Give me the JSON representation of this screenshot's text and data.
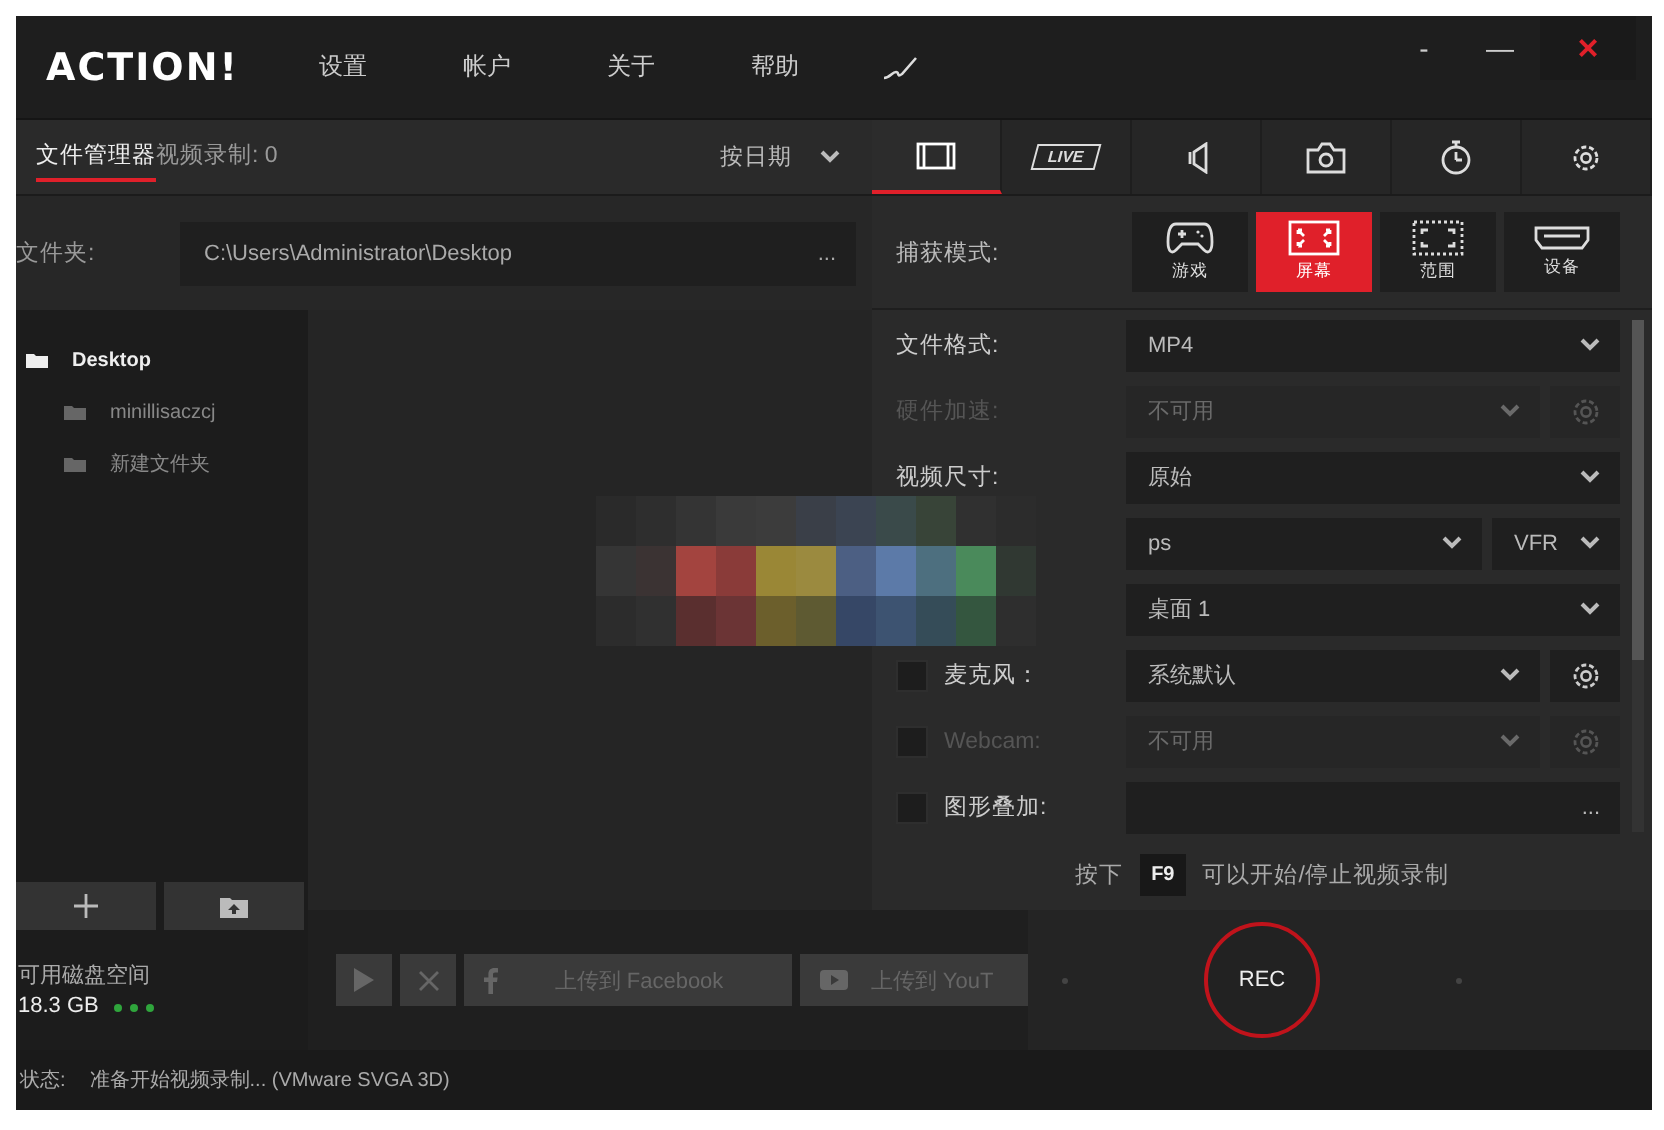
{
  "window": {
    "logo": "ACTION!",
    "menu": [
      "设置",
      "帐户",
      "关于",
      "帮助"
    ],
    "controls": [
      {
        "kind": "minimize_small",
        "label": "-"
      },
      {
        "kind": "minimize",
        "label": "—"
      },
      {
        "kind": "close",
        "label": "×"
      }
    ]
  },
  "file_manager": {
    "tabs": [
      {
        "label": "文件管理器",
        "selected": true
      },
      {
        "label": "视频录制: 0",
        "selected": false
      }
    ],
    "sort": "按日期",
    "folder_label": "文件夹:",
    "folder_path": "C:\\Users\\Administrator\\Desktop",
    "browse": "...",
    "tree": [
      {
        "label": "Desktop",
        "selected": true,
        "children": [
          {
            "label": "minillisaczcj",
            "selected": false
          },
          {
            "label": "新建文件夹",
            "selected": false
          }
        ]
      }
    ],
    "disk_label": "可用磁盘空间",
    "disk_free": "18.3 GB"
  },
  "upload_bar": {
    "facebook": "上传到 Facebook",
    "youtube": "上传到 YouT"
  },
  "record": {
    "tabs": [
      {
        "kind": "video",
        "selected": true
      },
      {
        "kind": "live",
        "label": "LIVE",
        "selected": false
      },
      {
        "kind": "audio",
        "selected": false
      },
      {
        "kind": "screenshot",
        "selected": false
      },
      {
        "kind": "timer",
        "selected": false
      },
      {
        "kind": "settings",
        "selected": false
      }
    ],
    "capture_label": "捕获模式:",
    "modes": [
      {
        "kind": "game",
        "label": "游戏",
        "selected": false
      },
      {
        "kind": "screen",
        "label": "屏幕",
        "selected": true
      },
      {
        "kind": "area",
        "label": "范围",
        "selected": false
      },
      {
        "kind": "device",
        "label": "设备",
        "selected": false
      }
    ],
    "settings": [
      {
        "kind": "select",
        "label": "文件格式:",
        "value": "MP4",
        "disabled": false
      },
      {
        "kind": "select_gear",
        "label": "硬件加速:",
        "value": "不可用",
        "disabled": true
      },
      {
        "kind": "select",
        "label": "视频尺寸:",
        "value": "原始",
        "disabled": false
      },
      {
        "kind": "select_pair",
        "value": "ps",
        "value_2": "VFR",
        "disabled": false
      },
      {
        "kind": "select",
        "value": "桌面 1",
        "disabled": false
      },
      {
        "kind": "check_select_gear",
        "label": "麦克风：",
        "checked": false,
        "value": "系统默认",
        "disabled": false
      },
      {
        "kind": "check_select_gear",
        "label": "Webcam:",
        "checked": false,
        "value": "不可用",
        "disabled": true
      },
      {
        "kind": "check_field",
        "label": "图形叠加:",
        "checked": false,
        "button": "..."
      }
    ],
    "hint": {
      "prefix": "按下",
      "key": "F9",
      "suffix": "可以开始/停止视频录制"
    },
    "rec": "REC"
  },
  "status_bar": {
    "label": "状态:",
    "text": "准备开始视频录制... (VMware SVGA 3D)"
  }
}
